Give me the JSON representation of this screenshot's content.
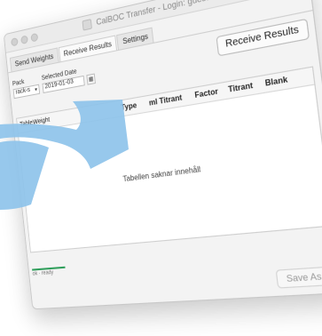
{
  "window": {
    "title": "CalBOC Transfer - Login: guest"
  },
  "tabs": [
    {
      "label": "Send Weights"
    },
    {
      "label": "Receive Results"
    },
    {
      "label": "Settings"
    }
  ],
  "controls": {
    "pack_label": "Pack",
    "pack_value": "rack-s",
    "date_label": "Selected Date",
    "date_value": "2019-01-03",
    "receive_button": "Receive Results"
  },
  "table": {
    "columns": [
      "Table",
      "Weight",
      "Type",
      "ml Titrant",
      "Factor",
      "Titrant",
      "Blank"
    ],
    "empty_text": "Tabellen saknar innehåll"
  },
  "status": {
    "text": "ok · ready"
  },
  "footer": {
    "save_button": "Save As..."
  },
  "colors": {
    "arrow": "#8ec3ea",
    "status_line": "#2f9e5b"
  }
}
